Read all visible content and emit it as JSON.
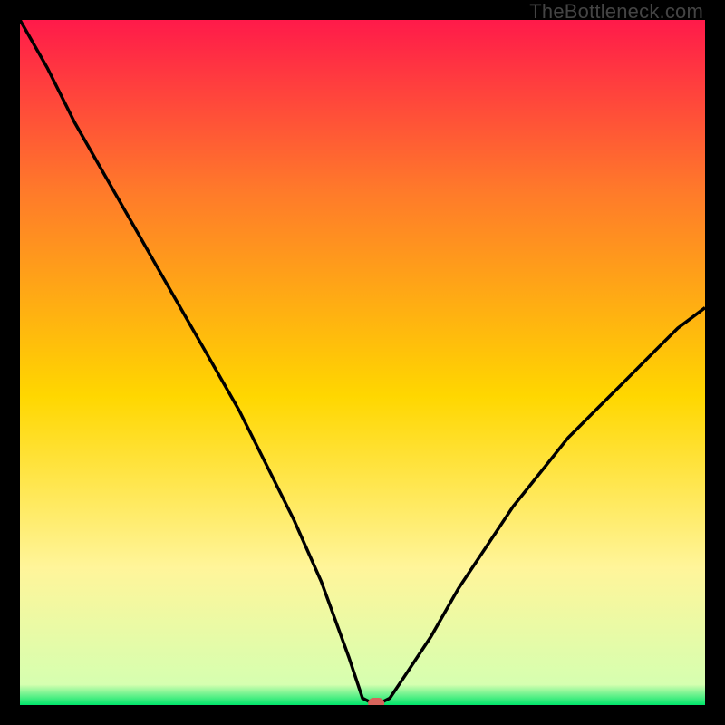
{
  "watermark": "TheBottleneck.com",
  "colors": {
    "top": "#ff1a4a",
    "upper_mid": "#ff7a2a",
    "mid": "#ffd700",
    "lower_mid": "#fff59a",
    "bottom": "#00e56a",
    "curve": "#000000",
    "marker": "#d7645c",
    "frame": "#000000"
  },
  "chart_data": {
    "type": "line",
    "title": "",
    "xlabel": "",
    "ylabel": "",
    "xlim": [
      0,
      100
    ],
    "ylim": [
      0,
      100
    ],
    "x": [
      0,
      4,
      8,
      12,
      16,
      20,
      24,
      28,
      32,
      36,
      40,
      44,
      48,
      50,
      52,
      54,
      56,
      60,
      64,
      68,
      72,
      76,
      80,
      84,
      88,
      92,
      96,
      100
    ],
    "values": [
      100,
      93,
      85,
      78,
      71,
      64,
      57,
      50,
      43,
      35,
      27,
      18,
      7,
      1,
      0,
      1,
      4,
      10,
      17,
      23,
      29,
      34,
      39,
      43,
      47,
      51,
      55,
      58
    ],
    "marker": {
      "x": 52,
      "y": 0
    },
    "gradient_stops": [
      {
        "offset": 0.0,
        "color": "#ff1a4a"
      },
      {
        "offset": 0.25,
        "color": "#ff7a2a"
      },
      {
        "offset": 0.55,
        "color": "#ffd700"
      },
      {
        "offset": 0.8,
        "color": "#fff59a"
      },
      {
        "offset": 0.97,
        "color": "#d6ffb0"
      },
      {
        "offset": 1.0,
        "color": "#00e56a"
      }
    ]
  }
}
